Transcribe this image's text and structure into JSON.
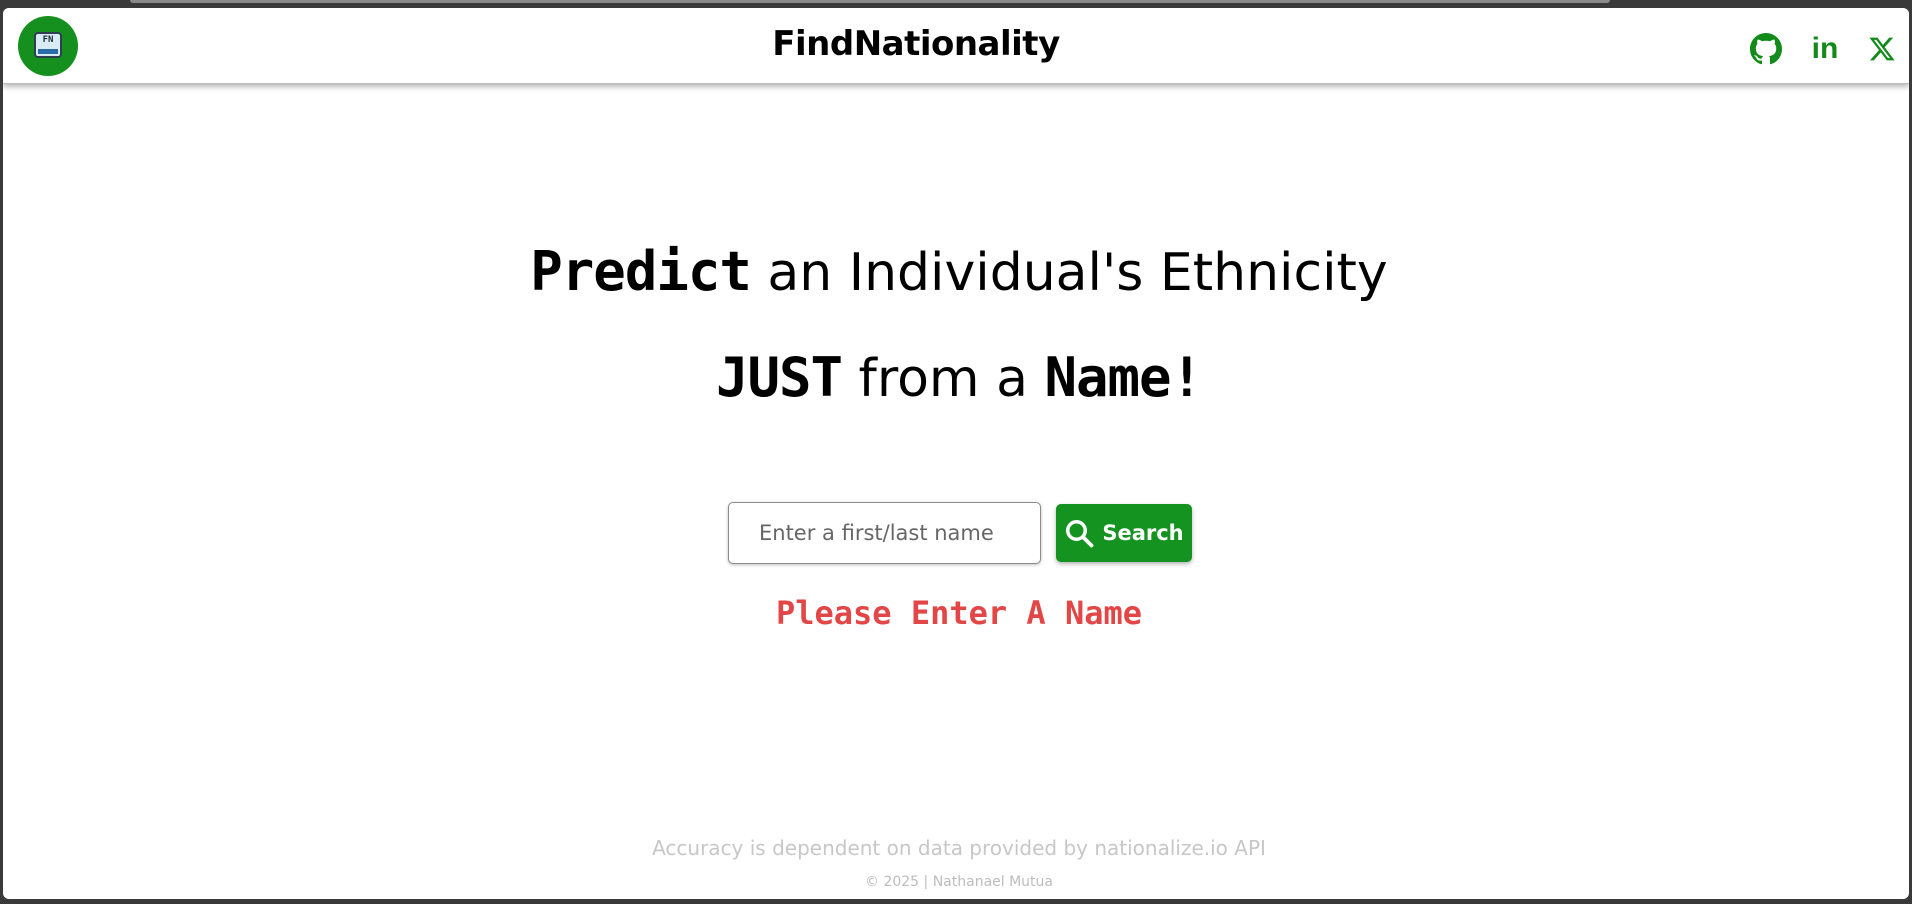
{
  "navbar": {
    "logo_text": "FN",
    "brand": "FindNationality",
    "social": [
      {
        "name": "github",
        "icon": "github-icon"
      },
      {
        "name": "linkedin",
        "icon": "linkedin-icon",
        "glyph": "in"
      },
      {
        "name": "x",
        "icon": "x-icon",
        "glyph": "𝕏"
      }
    ]
  },
  "hero": {
    "line1_bold": "Predict",
    "line1_rest": " an Individual's Ethnicity",
    "line2_bold1": "JUST",
    "line2_mid": " from a ",
    "line2_bold2": "Name!"
  },
  "search": {
    "placeholder": "Enter a first/last name",
    "value": "",
    "button_label": "Search",
    "button_icon": "search-icon"
  },
  "error_message": "Please Enter A Name",
  "footer": {
    "note": "Accuracy is dependent on data provided by nationalize.io API",
    "copyright": "© 2025 | Nathanael Mutua"
  },
  "colors": {
    "accent_green": "#149321",
    "error_red": "#e24646",
    "footer_gray": "#c7c7c7"
  }
}
